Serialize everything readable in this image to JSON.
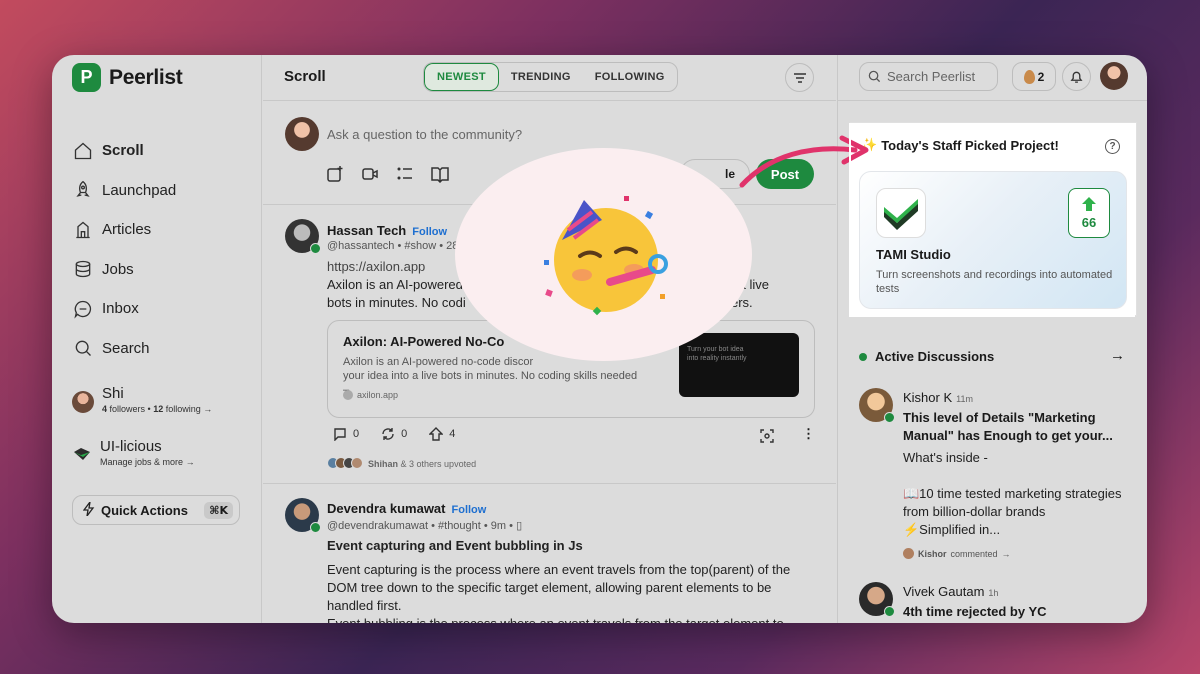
{
  "app": {
    "name": "Peerlist",
    "logo_letter": "P"
  },
  "sidebar": {
    "items": [
      {
        "label": "Scroll",
        "icon": "home-icon"
      },
      {
        "label": "Launchpad",
        "icon": "rocket-icon"
      },
      {
        "label": "Articles",
        "icon": "articles-icon"
      },
      {
        "label": "Jobs",
        "icon": "jobs-icon"
      },
      {
        "label": "Inbox",
        "icon": "inbox-icon"
      },
      {
        "label": "Search",
        "icon": "search-icon"
      }
    ],
    "profile": {
      "name": "Shi",
      "followers": "4",
      "followers_label": "followers •",
      "following": "12",
      "following_label": "following"
    },
    "org": {
      "name": "UI-licious",
      "sub": "Manage jobs & more"
    },
    "quick_actions": {
      "label": "Quick Actions",
      "shortcut": "⌘K"
    }
  },
  "feed": {
    "title": "Scroll",
    "tabs": [
      "NEWEST",
      "TRENDING",
      "FOLLOWING"
    ],
    "composer": {
      "placeholder": "Ask a question to the community?",
      "schedule_fragment": "le",
      "post_label": "Post"
    },
    "post1": {
      "author": "Hassan Tech",
      "follow": "Follow",
      "handle": "@hassantech • #show • 28",
      "link": "https://axilon.app",
      "text_line1": "Axilon is an AI-powered",
      "text_line1_end": "nto a live",
      "text_line2": "bots in minutes. No codi",
      "text_line2_end": "ers.",
      "card_title": "Axilon: AI-Powered No-Co",
      "card_desc1": "Axilon is an AI-powered no-code discor",
      "card_desc2": "your idea into a live bots in minutes. No coding skills needed –",
      "card_source": "axilon.app",
      "card_img_text": "Turn your bot idea into reality instantly",
      "comments": "0",
      "reposts": "0",
      "upvotes": "4",
      "upvoted_by": "Shihan",
      "upvoted_rest": "& 3 others upvoted"
    },
    "post2": {
      "author": "Devendra kumawat",
      "follow": "Follow",
      "handle": "@devendrakumawat • #thought • 9m •",
      "title": "Event capturing and Event bubbling in Js",
      "body1": "Event capturing is the process where an event travels from the top(parent) of the",
      "body2": "DOM tree down to the specific target element, allowing parent elements to be",
      "body3": "handled first.",
      "body4": "Event bubbling is the process where an event travels from the target element to"
    }
  },
  "right": {
    "search_placeholder": "Search Peerlist",
    "coins": "2",
    "staff_pick": {
      "title": "Today's Staff Picked Project!",
      "project_name": "TAMI Studio",
      "project_desc": "Turn screenshots and recordings into automated tests",
      "upvotes": "66"
    },
    "active_discussions": {
      "title": "Active Discussions",
      "items": [
        {
          "name": "Kishor K",
          "time": "11m",
          "headline": "This level of Details \"Marketing Manual\" has Enough to get your...",
          "body1": "What's inside -",
          "body2": "📖10 time tested marketing strategies from billion-dollar brands",
          "body3": "⚡Simplified in...",
          "footer_name": "Kishor",
          "footer_rest": "commented"
        },
        {
          "name": "Vivek Gautam",
          "time": "1h",
          "headline": "4th time rejected by YC"
        }
      ]
    }
  },
  "overlay": {
    "emoji": "🥳"
  },
  "colors": {
    "brand_green": "#1e8a3f",
    "highlight_pink": "#e0336b"
  }
}
